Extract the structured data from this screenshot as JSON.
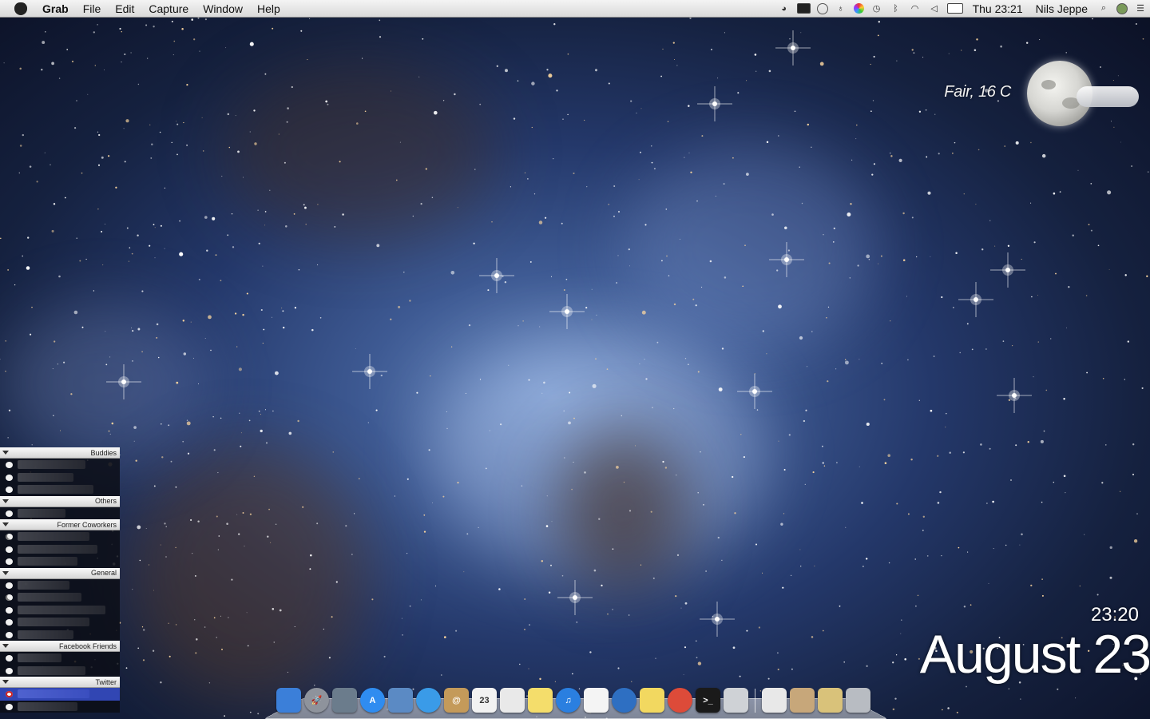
{
  "menubar": {
    "app_name": "Grab",
    "menus": [
      "File",
      "Edit",
      "Capture",
      "Window",
      "Help"
    ],
    "clock": "Thu 23:21",
    "user": "Nils Jeppe",
    "status_icons": [
      "adium-duck-icon",
      "terminal-icon",
      "speech-bubble-icon",
      "growl-icon",
      "colorwheel-icon",
      "time-machine-icon",
      "bluetooth-icon",
      "wifi-icon",
      "volume-icon",
      "battery-icon"
    ]
  },
  "weather": {
    "condition_text": "Fair, 16 C"
  },
  "desktop_clock": {
    "time": "23:20",
    "date": "August 23"
  },
  "buddy_list": {
    "groups": [
      {
        "label": "Buddies",
        "rows": [
          {
            "status": "available",
            "w": 85
          },
          {
            "status": "available",
            "w": 70
          },
          {
            "status": "available",
            "w": 95
          }
        ]
      },
      {
        "label": "Others",
        "rows": [
          {
            "status": "available",
            "w": 60
          }
        ]
      },
      {
        "label": "Former Coworkers",
        "rows": [
          {
            "status": "away",
            "w": 90
          },
          {
            "status": "available",
            "w": 100
          },
          {
            "status": "available",
            "w": 75
          }
        ]
      },
      {
        "label": "General",
        "rows": [
          {
            "status": "available",
            "w": 65
          },
          {
            "status": "away",
            "w": 80
          },
          {
            "status": "available",
            "w": 110
          },
          {
            "status": "available",
            "w": 90
          },
          {
            "status": "available",
            "w": 70
          }
        ]
      },
      {
        "label": "Facebook Friends",
        "rows": [
          {
            "status": "available",
            "w": 55
          },
          {
            "status": "available",
            "w": 85
          }
        ]
      },
      {
        "label": "Twitter",
        "rows": [
          {
            "status": "alert",
            "w": 90,
            "selected": true
          },
          {
            "status": "available",
            "w": 75
          }
        ]
      }
    ]
  },
  "dock": {
    "items": [
      {
        "name": "finder-icon",
        "color": "#3b7fd9",
        "shape": "square",
        "glyph": ""
      },
      {
        "name": "launchpad-icon",
        "color": "#8e939c",
        "shape": "round",
        "glyph": "🚀"
      },
      {
        "name": "dashboard-icon",
        "color": "#6b7c8c",
        "shape": "square",
        "glyph": ""
      },
      {
        "name": "app-store-icon",
        "color": "#2f8cf0",
        "shape": "round",
        "glyph": "A"
      },
      {
        "name": "preview-icon",
        "color": "#5b8ac4",
        "shape": "square",
        "glyph": ""
      },
      {
        "name": "safari-icon",
        "color": "#3a9be8",
        "shape": "round",
        "glyph": ""
      },
      {
        "name": "address-book-icon",
        "color": "#c49a5a",
        "shape": "square",
        "glyph": "@"
      },
      {
        "name": "calendar-icon",
        "color": "#f2f2f2",
        "shape": "square",
        "glyph": "23"
      },
      {
        "name": "reminders-icon",
        "color": "#e9e9e9",
        "shape": "square",
        "glyph": ""
      },
      {
        "name": "notes-icon",
        "color": "#f4dd6b",
        "shape": "square",
        "glyph": ""
      },
      {
        "name": "itunes-icon",
        "color": "#2a7fe0",
        "shape": "round",
        "glyph": "♫"
      },
      {
        "name": "textedit-icon",
        "color": "#f4f4f4",
        "shape": "square",
        "glyph": ""
      },
      {
        "name": "adium-icon",
        "color": "#2e6fc2",
        "shape": "round",
        "glyph": ""
      },
      {
        "name": "stickies-icon",
        "color": "#f2d860",
        "shape": "square",
        "glyph": ""
      },
      {
        "name": "chrome-icon",
        "color": "#dd4b39",
        "shape": "round",
        "glyph": ""
      },
      {
        "name": "terminal-icon",
        "color": "#1a1a1a",
        "shape": "square",
        "glyph": ">_"
      },
      {
        "name": "grab-icon",
        "color": "#cfd2d6",
        "shape": "square",
        "glyph": ""
      },
      {
        "name": "documents-stack-icon",
        "color": "#e8e8e8",
        "shape": "square",
        "glyph": ""
      },
      {
        "name": "downloads-stack-icon",
        "color": "#c7a77a",
        "shape": "square",
        "glyph": ""
      },
      {
        "name": "applications-stack-icon",
        "color": "#d9c27a",
        "shape": "square",
        "glyph": ""
      },
      {
        "name": "trash-icon",
        "color": "#b8bcc2",
        "shape": "square",
        "glyph": ""
      }
    ]
  }
}
